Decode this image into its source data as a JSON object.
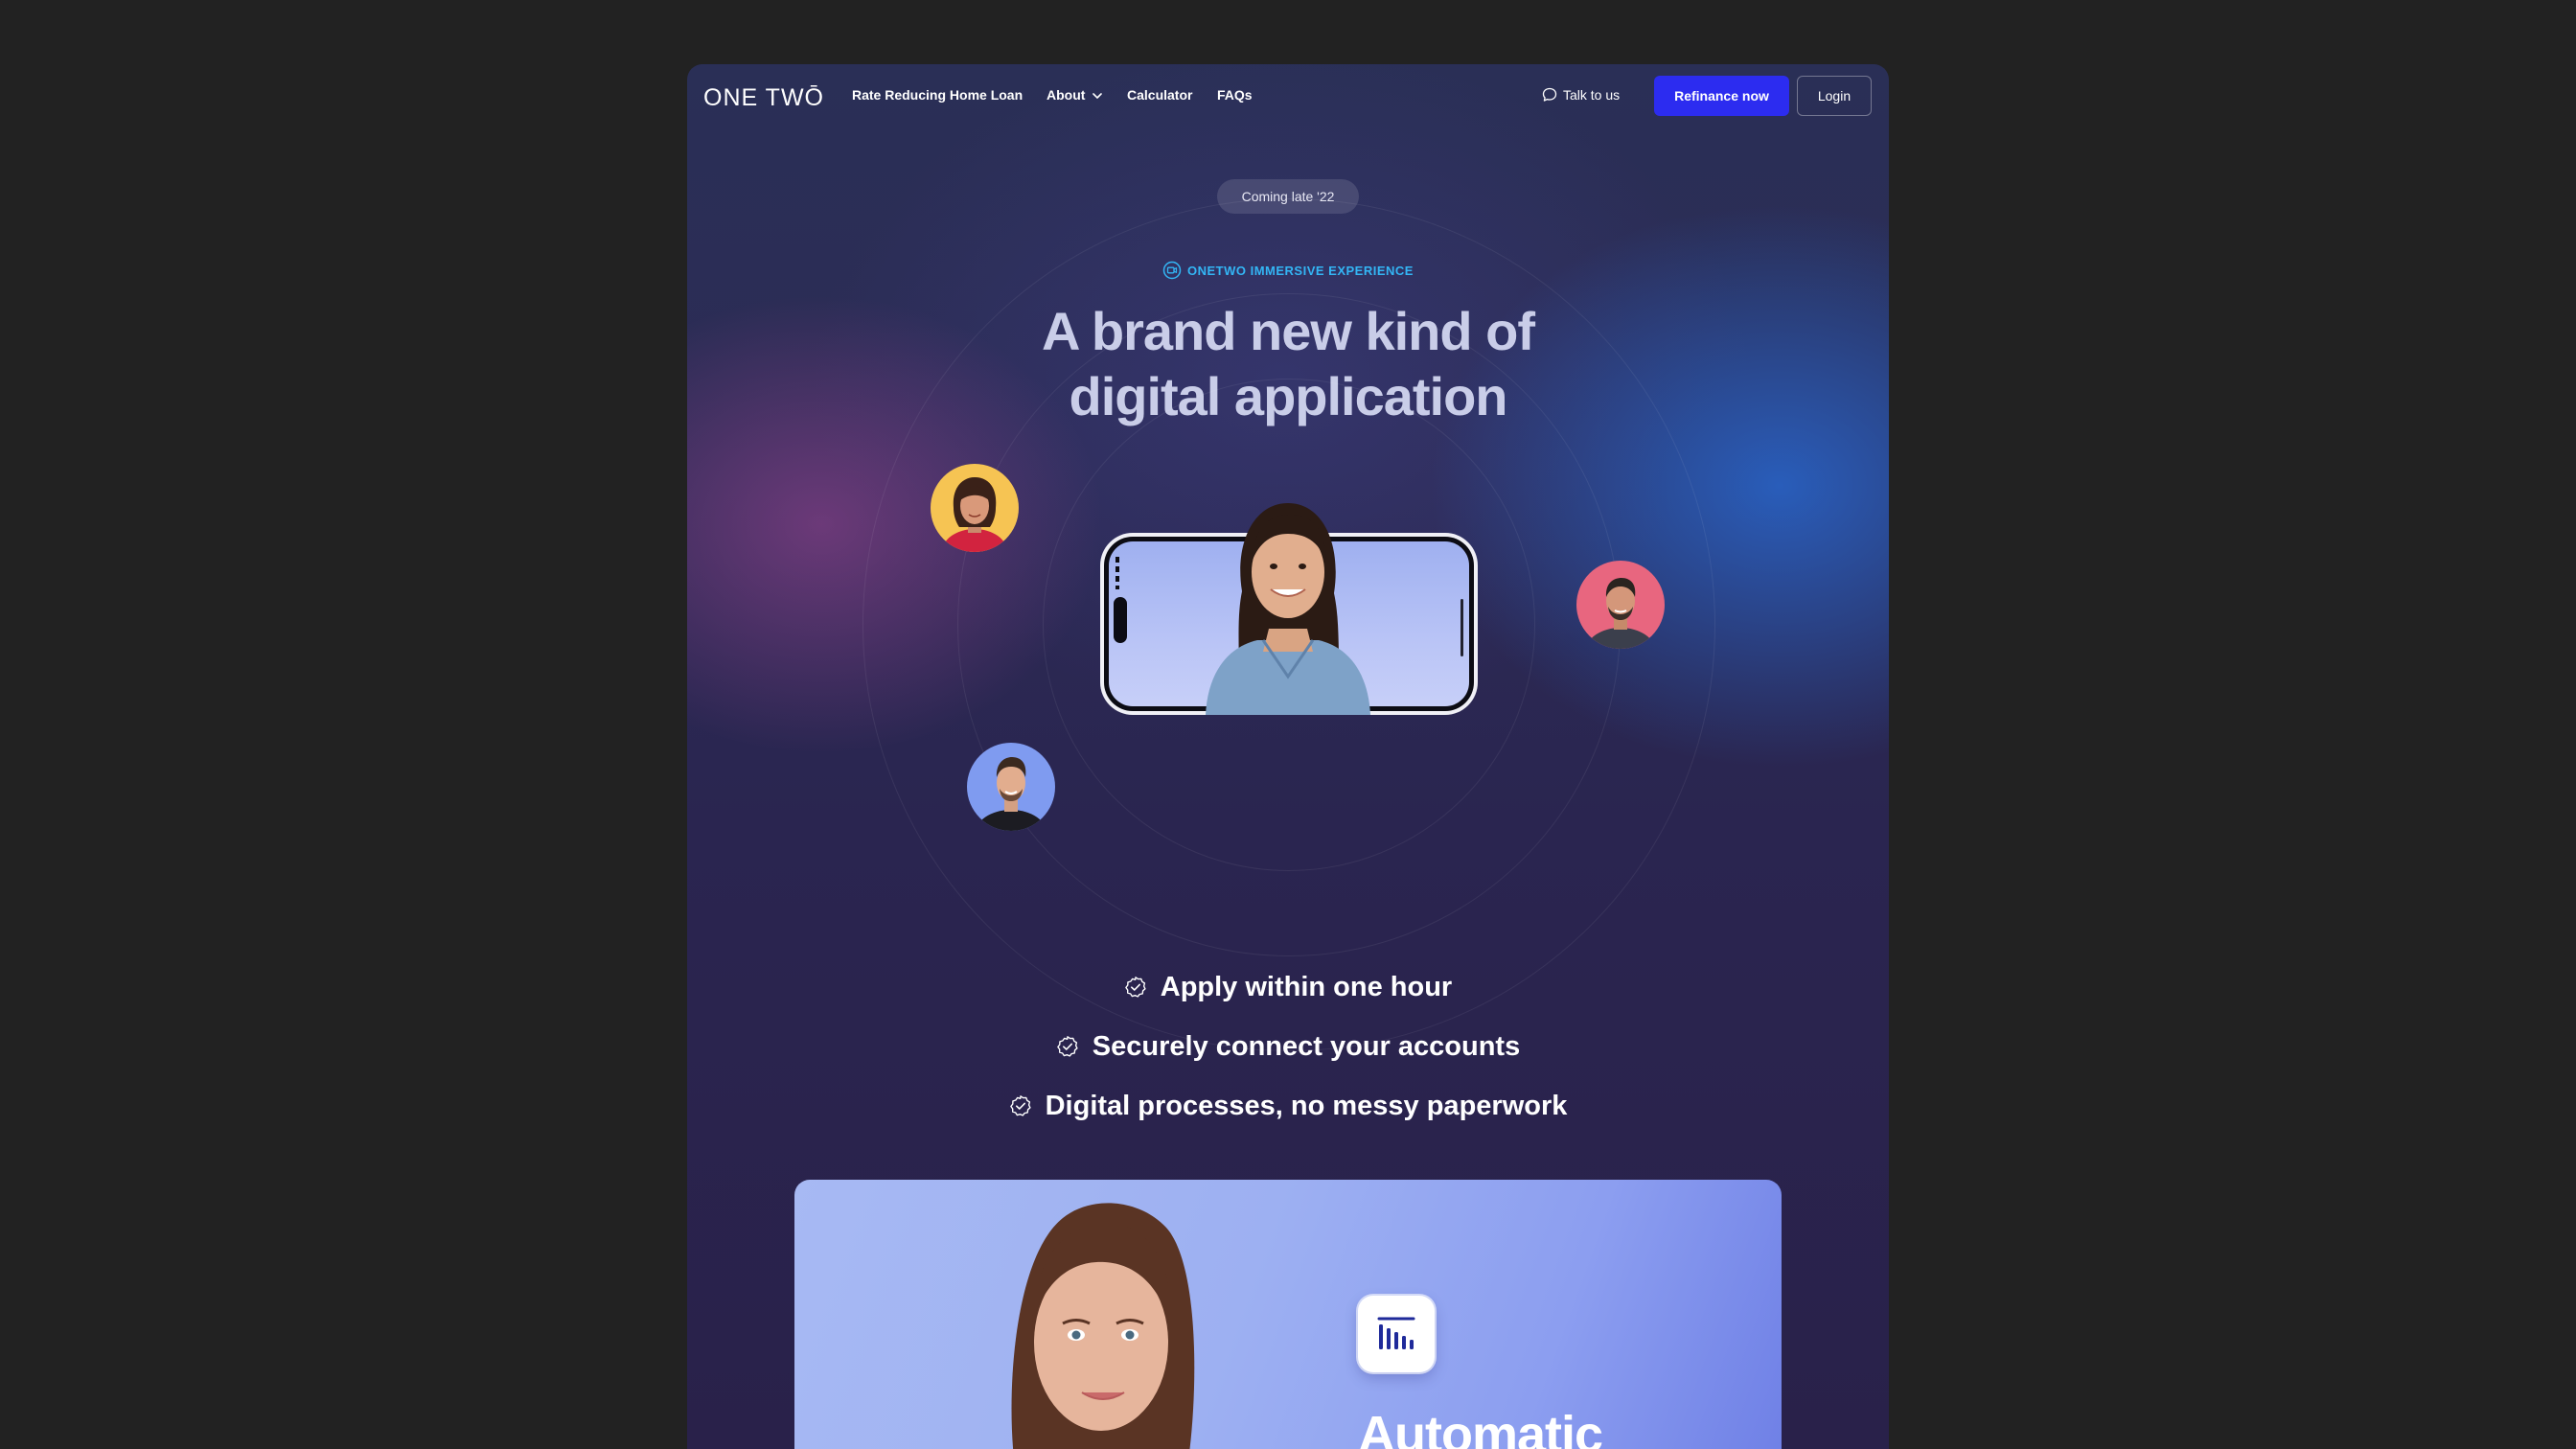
{
  "nav": {
    "logo": "ONE TWŌ",
    "links": {
      "rate": "Rate Reducing Home Loan",
      "about": "About",
      "calculator": "Calculator",
      "faqs": "FAQs"
    },
    "talk": "Talk to us",
    "refinance": "Refinance now",
    "login": "Login"
  },
  "hero": {
    "badge": "Coming late '22",
    "eyebrow": "ONETWO IMMERSIVE EXPERIENCE",
    "headline_line1": "A brand new kind of",
    "headline_line2": "digital application"
  },
  "features": [
    "Apply within one hour",
    "Securely connect your accounts",
    "Digital processes, no messy paperwork"
  ],
  "card": {
    "title": "Automatic"
  },
  "colors": {
    "page_background": "#222222",
    "accent_blue": "#2c2cf0",
    "eyebrow_cyan": "#33b6f5",
    "headline": "#c9cde8"
  },
  "icons": {
    "about_chevron": "chevron-down-icon",
    "talk": "chat-bubble-icon",
    "eyebrow": "video-icon",
    "feature_check": "check-badge-icon",
    "card_icon": "bars-chart-icon"
  }
}
